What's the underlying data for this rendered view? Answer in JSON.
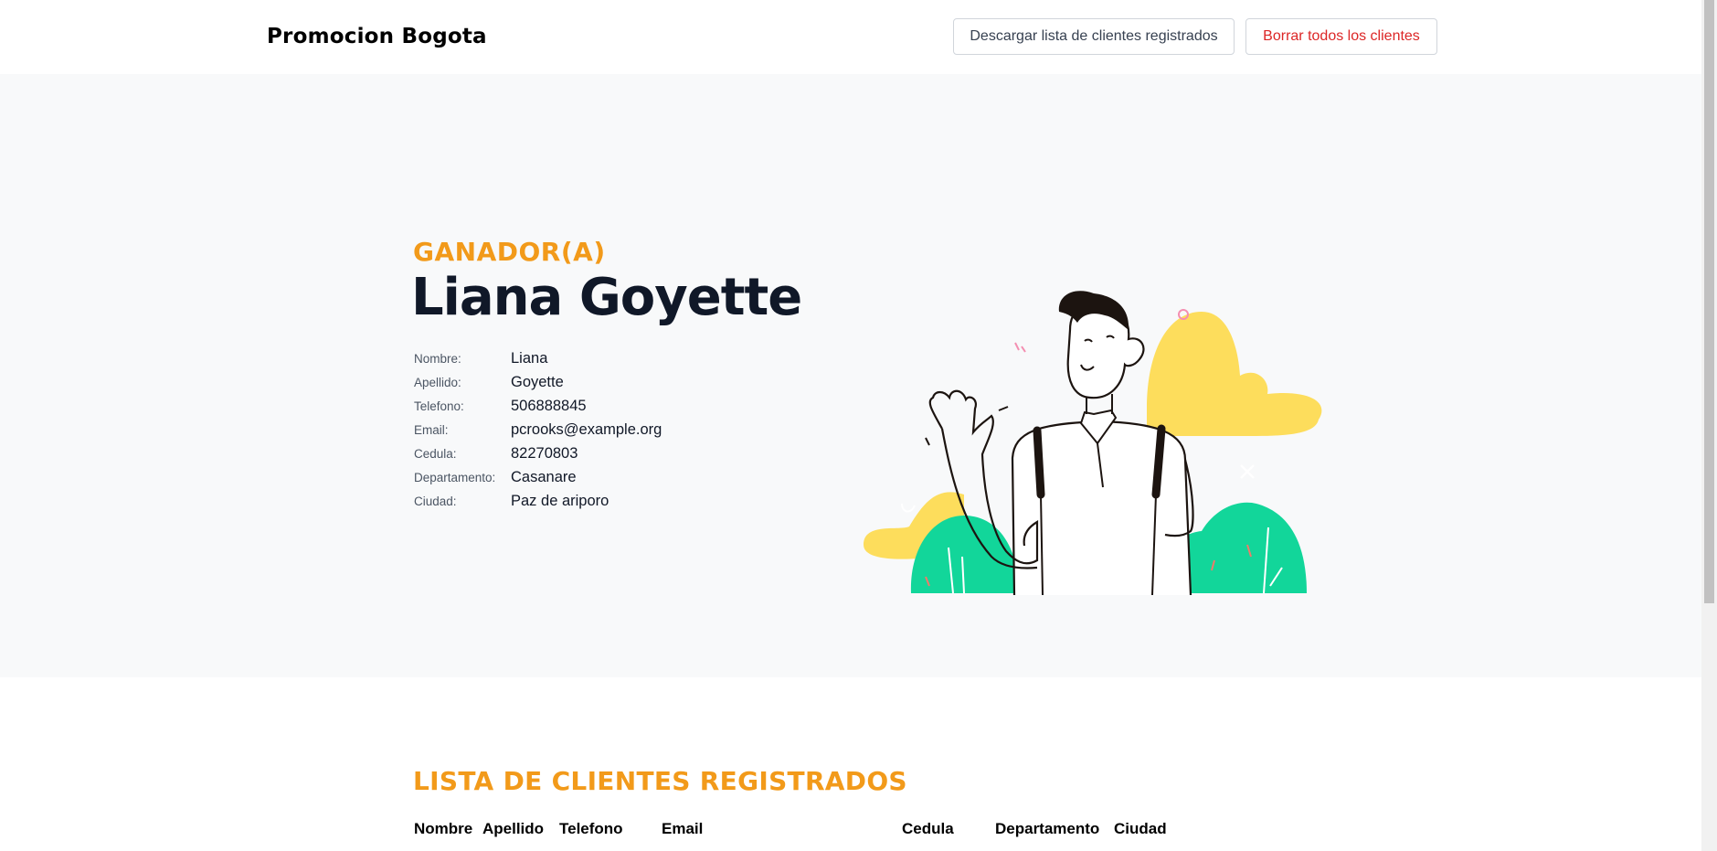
{
  "header": {
    "brand": "Promocion Bogota",
    "download_button": "Descargar lista de clientes registrados",
    "delete_button": "Borrar todos los clientes"
  },
  "winner": {
    "eyebrow": "GANADOR(A)",
    "full_name": "Liana Goyette",
    "details": [
      {
        "label": "Nombre:",
        "value": "Liana"
      },
      {
        "label": "Apellido:",
        "value": "Goyette"
      },
      {
        "label": "Telefono:",
        "value": "506888845"
      },
      {
        "label": "Email:",
        "value": "pcrooks@example.org"
      },
      {
        "label": "Cedula:",
        "value": "82270803"
      },
      {
        "label": "Departamento:",
        "value": "Casanare"
      },
      {
        "label": "Ciudad:",
        "value": "Paz de ariporo"
      }
    ]
  },
  "clients": {
    "title": "LISTA DE CLIENTES REGISTRADOS",
    "columns": [
      "Nombre",
      "Apellido",
      "Telefono",
      "Email",
      "Cedula",
      "Departamento",
      "Ciudad"
    ]
  },
  "colors": {
    "accent": "#f29a1a",
    "danger": "#dc2626",
    "hero_bg": "#f8f9fa",
    "bush_green": "#12d69a",
    "cloud_yellow": "#fddd5c"
  },
  "illustration": {
    "icon": "waving-man-illustration"
  }
}
